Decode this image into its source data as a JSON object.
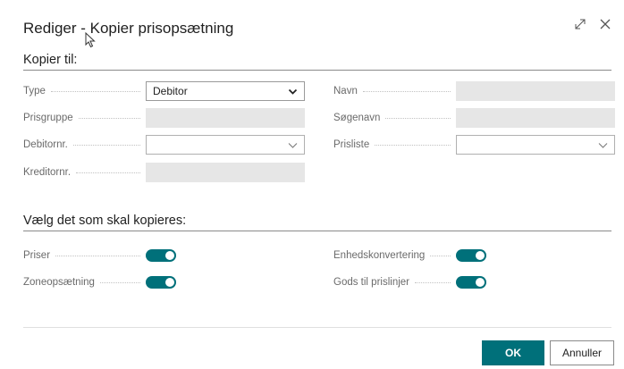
{
  "dialog": {
    "title": "Rediger - Kopier prisopsætning",
    "expand_icon": "expand-icon",
    "close_icon": "close-icon"
  },
  "copy_to": {
    "heading": "Kopier til:",
    "type_label": "Type",
    "type_value": "Debitor",
    "price_group_label": "Prisgruppe",
    "customer_no_label": "Debitornr.",
    "vendor_no_label": "Kreditornr.",
    "name_label": "Navn",
    "search_name_label": "Søgenavn",
    "price_list_label": "Prisliste"
  },
  "copy_what": {
    "heading": "Vælg det som skal kopieres:",
    "prices_label": "Priser",
    "prices_on": true,
    "zone_setup_label": "Zoneopsætning",
    "zone_setup_on": true,
    "unit_conversion_label": "Enhedskonvertering",
    "unit_conversion_on": true,
    "freight_label": "Gods til prislinjer",
    "freight_on": true
  },
  "footer": {
    "ok_label": "OK",
    "cancel_label": "Annuller"
  },
  "colors": {
    "accent": "#00707a",
    "readonly_field": "#e6e6e6"
  }
}
